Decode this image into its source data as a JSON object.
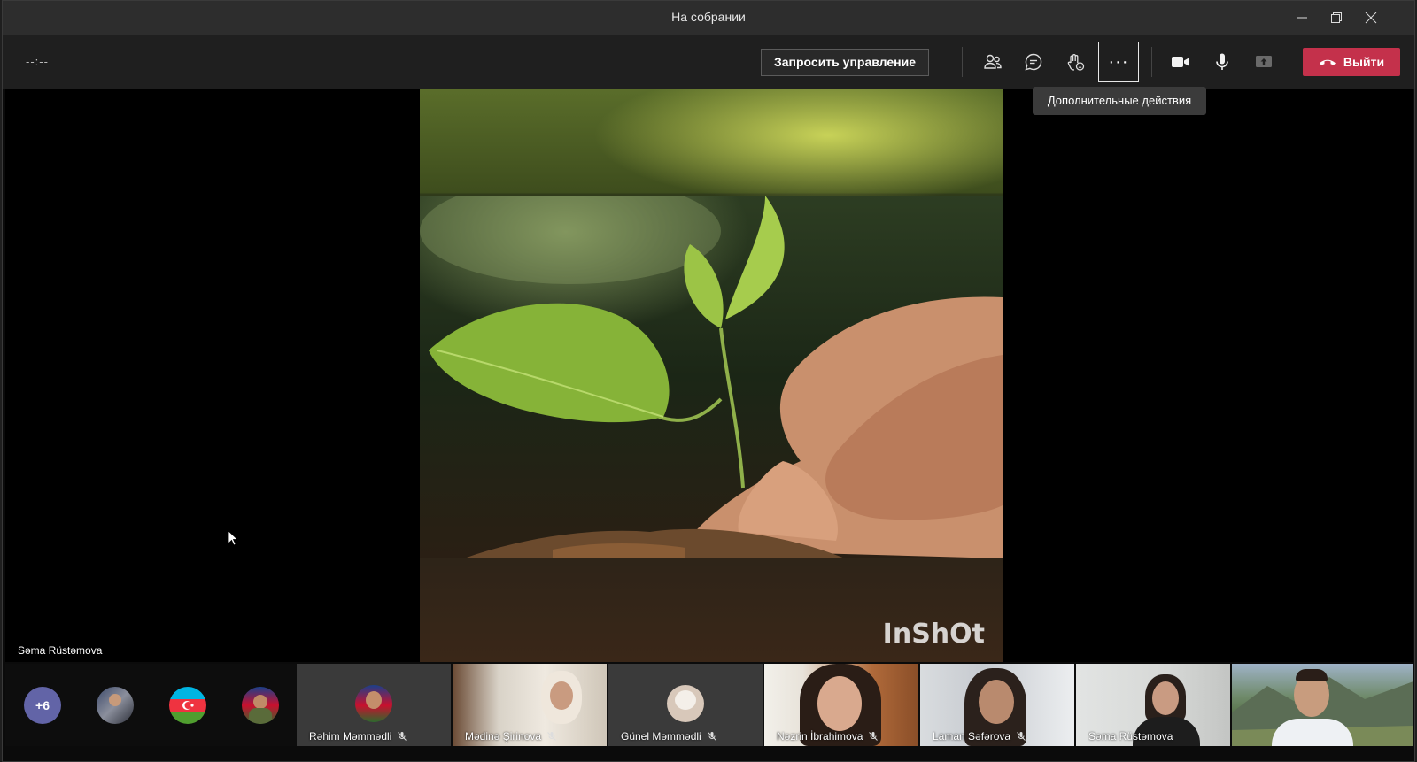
{
  "window": {
    "title": "На собрании"
  },
  "toolbar": {
    "timer": "--:--",
    "request_control_label": "Запросить управление",
    "leave_label": "Выйти",
    "more_actions_tooltip": "Дополнительные действия",
    "more_actions_glyph": "···"
  },
  "stage": {
    "speaker_name": "Səma Rüstəmova",
    "watermark": "InShOt"
  },
  "participants": {
    "overflow_count": "+6",
    "tiles": [
      {
        "name": "Rəhim Məmmədli",
        "muted": true
      },
      {
        "name": "Mədinə Şirinova",
        "muted": true
      },
      {
        "name": "Günel Məmmədli",
        "muted": true
      },
      {
        "name": "Nəzrin İbrahimova",
        "muted": true
      },
      {
        "name": "Laman Səfərova",
        "muted": true
      },
      {
        "name": "Səma Rüstəmova",
        "muted": false
      }
    ]
  },
  "colors": {
    "leave": "#c4314b",
    "accent": "#6264a7"
  }
}
